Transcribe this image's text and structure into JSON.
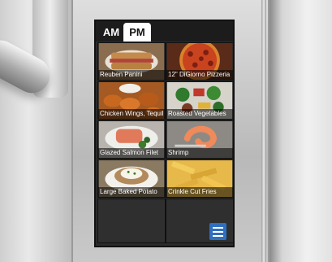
{
  "tabs": {
    "am_label": "AM",
    "pm_label": "PM",
    "selected": "PM"
  },
  "menu_items": [
    {
      "label": "Reuben Panini"
    },
    {
      "label": "12\" DiGiorno Pizzeria"
    },
    {
      "label": "Chicken Wings, Tequil"
    },
    {
      "label": "Roasted Vegetables"
    },
    {
      "label": "Glazed Salmon Filet"
    },
    {
      "label": "Shrimp"
    },
    {
      "label": "Large Baked Potato"
    },
    {
      "label": "Crinkle Cut Fries"
    }
  ],
  "menu_button": {
    "icon": "hamburger-menu-icon"
  },
  "colors": {
    "menu_button": "#2f6fc0",
    "screen_bg": "#2b2b2b"
  }
}
